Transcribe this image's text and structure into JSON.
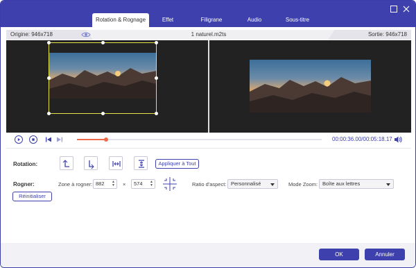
{
  "colors": {
    "accent": "#3d40ad",
    "progress": "#ee6a4a",
    "crop_frame": "#e6e64a"
  },
  "window": {
    "minimize_icon": "minimize-icon",
    "close_icon": "close-icon"
  },
  "tabs": [
    {
      "label": "Rotation & Rognage",
      "active": true
    },
    {
      "label": "Effet"
    },
    {
      "label": "Filigrane"
    },
    {
      "label": "Audio"
    },
    {
      "label": "Sous-titre"
    }
  ],
  "infobar": {
    "source": "Origine: 946x718",
    "filename": "1 naturel.m2ts",
    "output": "Sortie: 946x718"
  },
  "player": {
    "progress_fraction": 0.12,
    "current_time": "00:00:36.00",
    "total_time": "/00:05:18.17"
  },
  "rotation": {
    "label": "Rotation:",
    "apply_all": "Appliquer à Tout"
  },
  "crop": {
    "label": "Rogner:",
    "zone_label": "Zone à rogner:",
    "width": "882",
    "times": "×",
    "height": "574",
    "aspect_label": "Ratio d'aspect:",
    "aspect_value": "Personnalisé",
    "zoom_label": "Mode Zoom:",
    "zoom_value": "Boîte aux lettres",
    "reset": "Réinitialiser"
  },
  "footer": {
    "ok": "OK",
    "cancel": "Annuler"
  }
}
